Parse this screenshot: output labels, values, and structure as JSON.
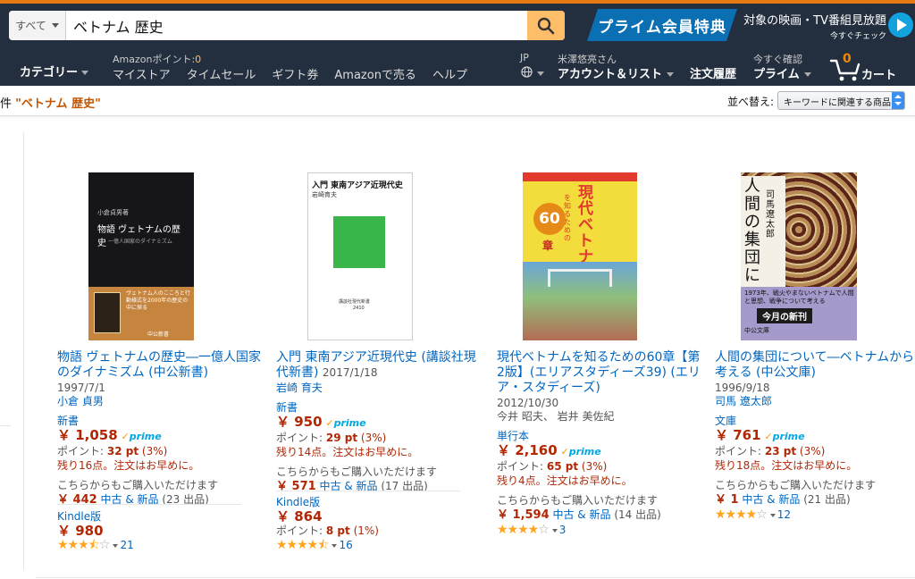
{
  "header": {
    "search_category": "すべて",
    "search_query": "ベトナム 歴史",
    "prime_banner": "プライム会員特典",
    "promo_title": "対象の映画・TV番組見放題",
    "promo_sub": "今すぐチェック"
  },
  "nav": {
    "departments": "カテゴリー",
    "points_label": "Amazonポイント:",
    "points_value": "0",
    "links": [
      "マイストア",
      "タイムセール",
      "ギフト券",
      "Amazonで売る",
      "ヘルプ"
    ],
    "language": "JP",
    "greeting": "米澤悠亮さん",
    "account": "アカウント＆リスト",
    "orders": "注文履歴",
    "try_prime": "今すぐ確認",
    "prime": "プライム",
    "cart_count": "0",
    "cart": "カート"
  },
  "results_bar": {
    "prefix": "件",
    "term": "\"ベトナム 歴史\"",
    "sort_label": "並べ替え:",
    "sort_value": "キーワードに関連する商品"
  },
  "products": [
    {
      "title": "物語 ヴェトナムの歴史―一億人国家のダイナミズム (中公新書)",
      "date": "1997/7/1",
      "author": "小倉 貞男",
      "format": "新書",
      "price": "￥ 1,058",
      "prime": "prime",
      "points": "ポイント:",
      "points_value": "32 pt",
      "points_pct": "(3%)",
      "stock": "残り16点。注文はお早めに。",
      "other_label": "こちらからもご購入いただけます",
      "other_price": "￥ 442",
      "other_link": "中古 & 新品",
      "other_count": "(23 出品)",
      "kindle_label": "Kindle版",
      "kindle_price": "￥ 980",
      "review_count": "21",
      "rating": 3.5,
      "cover_title": "物語 ヴェトナムの歴史",
      "cover_sub": "一億人国家のダイナミズム",
      "cover_author": "小倉貞男著",
      "cover_band": "ヴェトナム人のこころと行動様式を2000年の歴史の中に探る",
      "cover_pub": "中公新書"
    },
    {
      "title": "入門 東南アジア近現代史 (講談社現代新書)",
      "date": "2017/1/18",
      "author": "岩崎 育夫",
      "format": "新書",
      "price": "￥ 950",
      "prime": "prime",
      "points": "ポイント:",
      "points_value": "29 pt",
      "points_pct": "(3%)",
      "stock": "残り14点。注文はお早めに。",
      "other_label": "こちらからもご購入いただけます",
      "other_price": "￥ 571",
      "other_link": "中古 & 新品",
      "other_count": "(17 出品)",
      "kindle_label": "Kindle版",
      "kindle_price": "￥ 864",
      "kindle_points": "8 pt",
      "kindle_pct": "(1%)",
      "review_count": "16",
      "rating": 4.5,
      "cover_title": "入門 東南アジア近現代史",
      "cover_author": "岩崎育夫",
      "cover_pub": "講談社現代新書",
      "cover_num": "2410"
    },
    {
      "title": "現代ベトナムを知るための60章【第2版】(エリアスタディーズ39) (エリア・スタディーズ)",
      "date": "2012/10/30",
      "author": "今井 昭夫、 岩井 美佐紀",
      "format": "単行本",
      "price": "￥ 2,160",
      "prime": "prime",
      "points": "ポイント:",
      "points_value": "65 pt",
      "points_pct": "(3%)",
      "stock": "残り4点。注文はお早めに。",
      "other_label": "こちらからもご購入いただけます",
      "other_price": "￥ 1,594",
      "other_link": "中古 & 新品",
      "other_count": "(14 出品)",
      "review_count": "3",
      "rating": 4,
      "cover_title": "現代ベトナム",
      "cover_sub": "を知るための",
      "cover_num": "60",
      "cover_unit": "章"
    },
    {
      "title": "人間の集団について―ベトナムから考える (中公文庫)",
      "date": "1996/9/18",
      "author": "司馬 遼太郎",
      "format": "文庫",
      "price": "￥ 761",
      "prime": "prime",
      "points": "ポイント:",
      "points_value": "23 pt",
      "points_pct": "(3%)",
      "stock": "残り18点。注文はお早めに。",
      "other_label": "こちらからもご購入いただけます",
      "other_price": "￥ 1",
      "other_link": "中古 & 新品",
      "other_count": "(21 出品)",
      "review_count": "12",
      "rating": 4,
      "cover_title": "人間の集団に",
      "cover_author": "司馬遼太郎",
      "cover_band": "1973年、戦火やまないベトナムで人間と思想、戦争について考える",
      "cover_tag": "今月の新刊",
      "cover_pub": "中公文庫"
    }
  ]
}
